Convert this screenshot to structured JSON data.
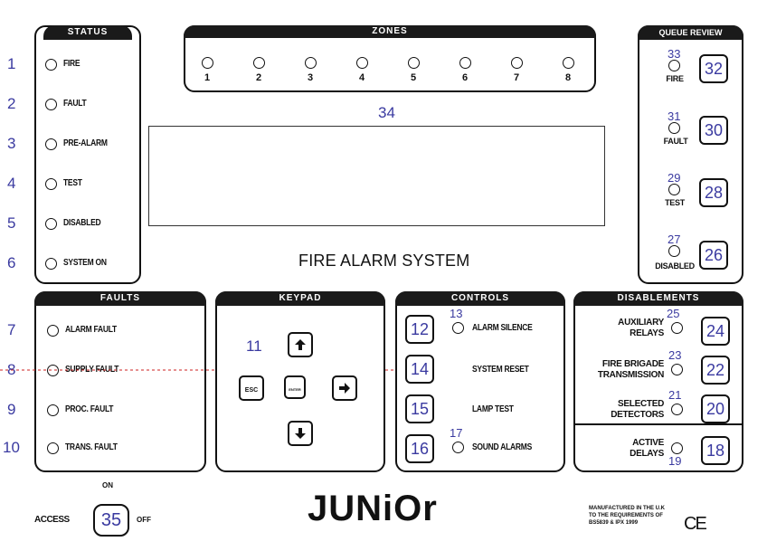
{
  "status": {
    "title": "STATUS",
    "items": [
      {
        "num": "1",
        "label": "FIRE"
      },
      {
        "num": "2",
        "label": "FAULT"
      },
      {
        "num": "3",
        "label": "PRE-ALARM"
      },
      {
        "num": "4",
        "label": "TEST"
      },
      {
        "num": "5",
        "label": "DISABLED"
      },
      {
        "num": "6",
        "label": "SYSTEM ON"
      }
    ]
  },
  "zones": {
    "title": "ZONES",
    "items": [
      "1",
      "2",
      "3",
      "4",
      "5",
      "6",
      "7",
      "8"
    ],
    "num": "34"
  },
  "display_title": "FIRE ALARM SYSTEM",
  "queue_review": {
    "title": "QUEUE REVIEW",
    "items": [
      {
        "led_num": "33",
        "label": "FIRE",
        "btn": "32"
      },
      {
        "led_num": "31",
        "label": "FAULT",
        "btn": "30"
      },
      {
        "led_num": "29",
        "label": "TEST",
        "btn": "28"
      },
      {
        "led_num": "27",
        "label": "DISABLED",
        "btn": "26"
      }
    ]
  },
  "faults": {
    "title": "FAULTS",
    "items": [
      {
        "num": "7",
        "label": "ALARM FAULT"
      },
      {
        "num": "8",
        "label": "SUPPLY FAULT"
      },
      {
        "num": "9",
        "label": "PROC. FAULT"
      },
      {
        "num": "10",
        "label": "TRANS. FAULT"
      }
    ]
  },
  "keypad": {
    "title": "KEYPAD",
    "num": "11",
    "esc": "ESC",
    "enter": "ENTER",
    "up_icon": "arrow-up-icon",
    "down_icon": "arrow-down-icon",
    "right_icon": "arrow-right-icon"
  },
  "controls": {
    "title": "CONTROLS",
    "items": [
      {
        "btn": "12",
        "led_num": "13",
        "label": "ALARM SILENCE"
      },
      {
        "btn": "14",
        "led_num": "",
        "label": "SYSTEM RESET"
      },
      {
        "btn": "15",
        "led_num": "",
        "label": "LAMP TEST"
      },
      {
        "btn": "16",
        "led_num": "17",
        "label": "SOUND ALARMS"
      }
    ]
  },
  "disablements": {
    "title": "DISABLEMENTS",
    "items": [
      {
        "label1": "AUXILIARY",
        "label2": "RELAYS",
        "led_num": "25",
        "btn": "24"
      },
      {
        "label1": "FIRE BRIGADE",
        "label2": "TRANSMISSION",
        "led_num": "23",
        "btn": "22"
      },
      {
        "label1": "SELECTED",
        "label2": "DETECTORS",
        "led_num": "21",
        "btn": "20"
      },
      {
        "label1": "ACTIVE",
        "label2": "DELAYS",
        "led_num": "19",
        "btn": "18"
      }
    ]
  },
  "access": {
    "label": "ACCESS",
    "on": "ON",
    "off": "OFF",
    "btn": "35"
  },
  "brand": "JUNiOr",
  "manufacture_note": [
    "MANUFACTURED IN THE U.K",
    "TO THE REQUIREMENTS OF",
    "BS5839 & IPX 1999"
  ],
  "ce_mark": "CE"
}
